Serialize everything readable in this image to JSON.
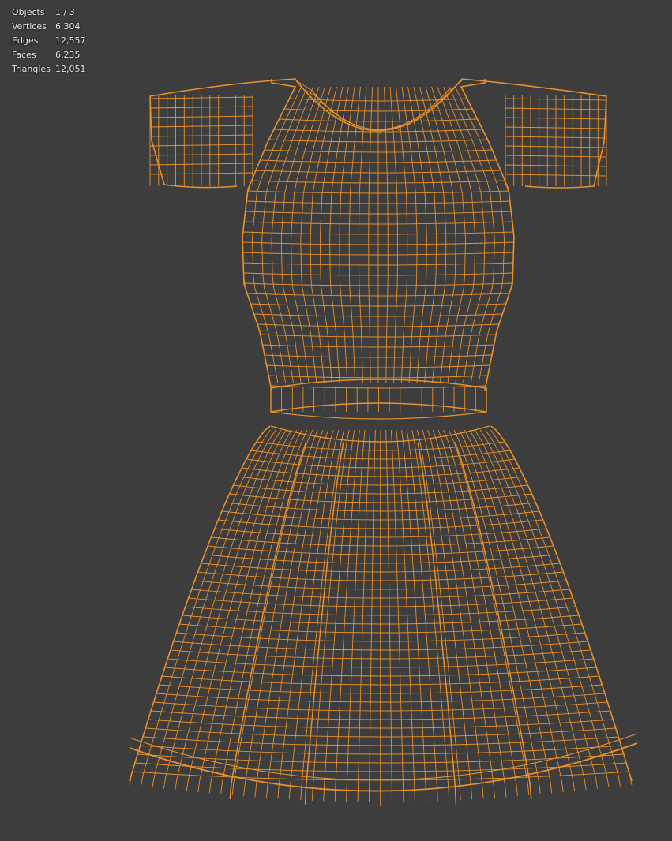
{
  "overlay": {
    "stats": [
      {
        "label": "Objects",
        "value": "1 / 3"
      },
      {
        "label": "Vertices",
        "value": "6,304"
      },
      {
        "label": "Edges",
        "value": "12,557"
      },
      {
        "label": "Faces",
        "value": "6,235"
      },
      {
        "label": "Triangles",
        "value": "12,051"
      }
    ]
  },
  "colors": {
    "background": "#3d3d3d",
    "wire": "#e8902c",
    "wire_light": "#f0a040",
    "text": "#e6e6e6"
  },
  "scene": {
    "object": "dress-mesh",
    "display": "wireframe",
    "selected": true
  }
}
